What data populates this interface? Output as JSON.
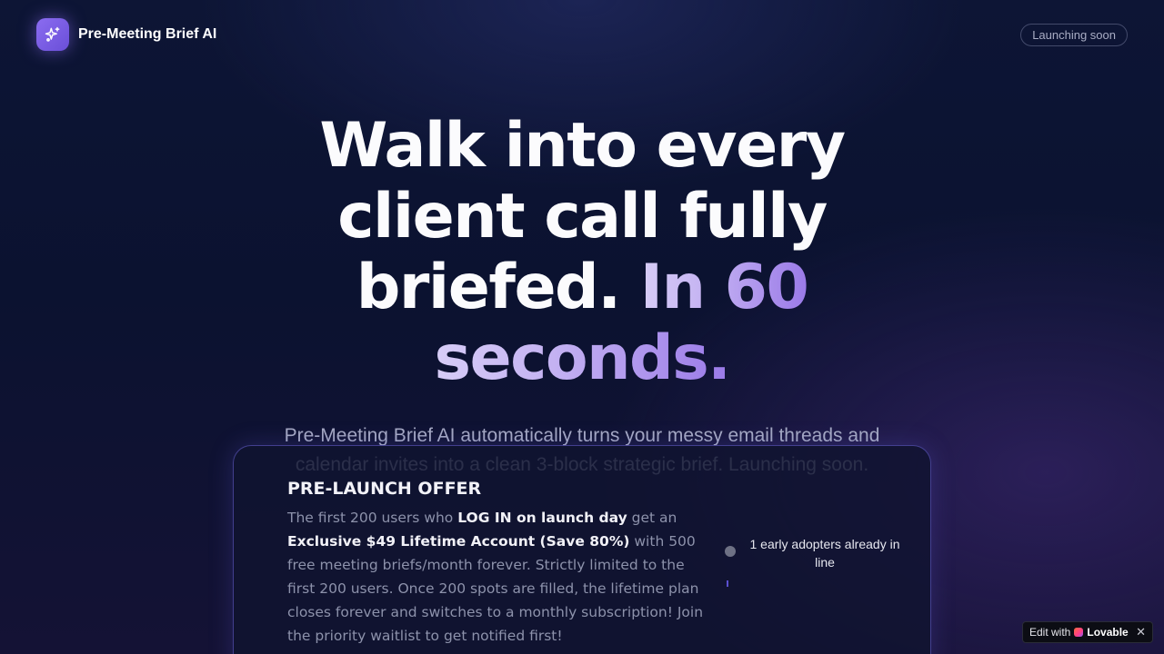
{
  "header": {
    "brand_name": "Pre-Meeting Brief AI",
    "logo_icon": "sparkles-icon",
    "status_pill": "Launching soon"
  },
  "hero": {
    "headline_main": "Walk into every client call fully briefed.",
    "headline_accent_1": "In 60",
    "headline_accent_2": "seconds.",
    "subheadline": "Pre-Meeting Brief AI automatically turns your messy email threads and calendar invites into a clean 3-block strategic brief. Launching soon."
  },
  "offer": {
    "title": "PRE-LAUNCH OFFER",
    "body_part1": "The first 200 users who ",
    "body_bold1": "LOG IN on launch day",
    "body_part2": " get an ",
    "body_bold2": "Exclusive $49 Lifetime Account (Save 80%)",
    "body_part3": " with 500 free meeting briefs/month forever. Strictly limited to the first 200 users. Once 200 spots are filled, the lifetime plan closes forever and switches to a monthly subscription! Join the priority waitlist to get notified first!",
    "counter_text": "1 early adopters already in line"
  },
  "badge": {
    "prefix": "Edit with",
    "brand": "Lovable",
    "close": "✕"
  },
  "colors": {
    "background": "#0b1230",
    "accent": "#9a7ae8",
    "card_border": "#6e64dc"
  }
}
